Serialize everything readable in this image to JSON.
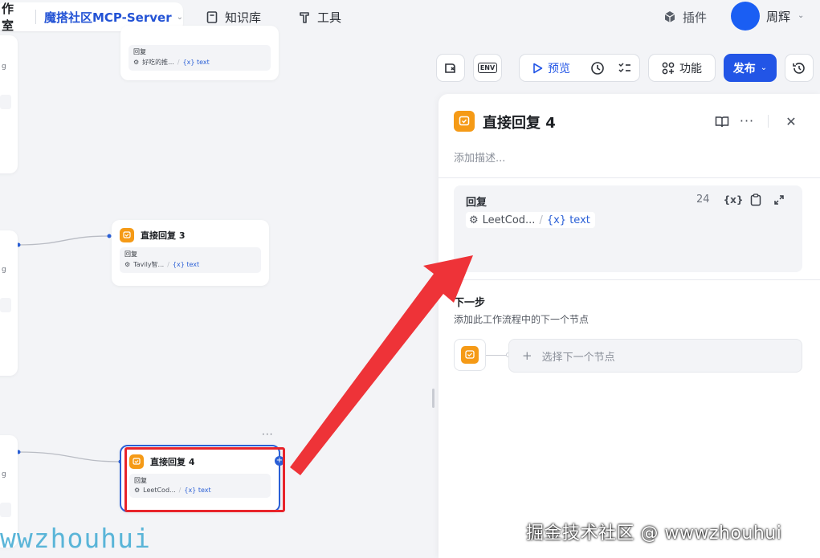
{
  "header": {
    "workspace_fragment": "作室",
    "project_name": "魔搭社区MCP-Server",
    "nav": [
      {
        "label": "知识库",
        "icon": "book-icon"
      },
      {
        "label": "工具",
        "icon": "hammer-icon"
      }
    ],
    "plugins_label": "插件",
    "user_name": "周辉"
  },
  "toolbar": {
    "preview_label": "预览",
    "features_label": "功能",
    "publish_label": "发布",
    "env_label": "ENV"
  },
  "canvas": {
    "top_node": {
      "field_label": "回复",
      "chip_text": "好吃的推...",
      "chip_var": "{x} text"
    },
    "node3": {
      "title": "直接回复 3",
      "field_label": "回复",
      "chip_text": "Tavily智...",
      "chip_var": "{x} text"
    },
    "node4": {
      "title": "直接回复 4",
      "field_label": "回复",
      "chip_text": "LeetCod...",
      "chip_var": "{x} text"
    },
    "left_fragment_a": "g",
    "left_fragment_b": "g",
    "left_fragment_c": "g"
  },
  "panel": {
    "title": "直接回复 4",
    "description_placeholder": "添加描述...",
    "reply": {
      "label": "回复",
      "count": "24",
      "chip_text": "LeetCod...",
      "chip_var": "{x} text"
    },
    "next_step": {
      "title": "下一步",
      "description": "添加此工作流程中的下一个节点",
      "select_placeholder": "选择下一个节点"
    }
  },
  "watermarks": {
    "left": "wwzhouhui",
    "right": "掘金技术社区 @ wwwzhouhui"
  },
  "colors": {
    "accent": "#2255e6",
    "node_badge": "#f59a16",
    "highlight": "#e8242b",
    "project_name": "#2353d5"
  }
}
